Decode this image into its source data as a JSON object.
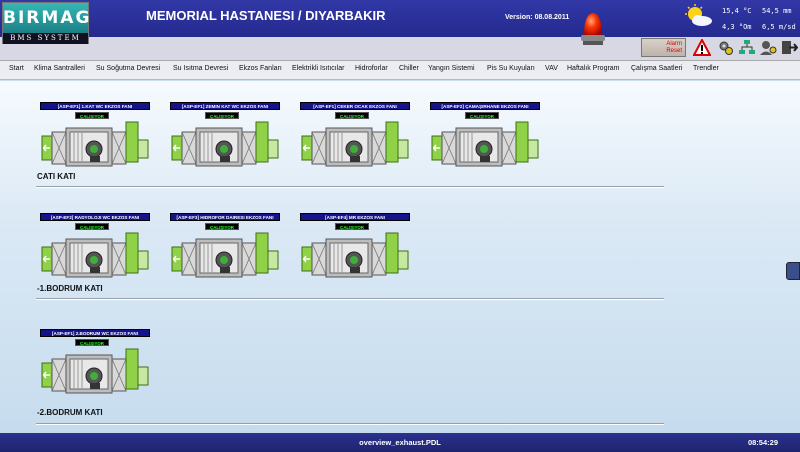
{
  "header": {
    "logo_main": "BIRMAG",
    "logo_sub": "BMS SYSTEM",
    "title": "MEMORIAL HASTANESI / DIYARBAKIR",
    "version": "Version: 08.08.2011"
  },
  "weather": {
    "temp": "15,4 °C",
    "pressure": "54,5 mm",
    "humidity": "4,3 °Om",
    "wind": "6,5 m/sd"
  },
  "toolbar": {
    "alarm_reset_line1": "Alarm",
    "alarm_reset_line2": "Reset"
  },
  "nav": [
    "Start",
    "Klima Santralleri",
    "Su Soğutma Devresi",
    "Su Isıtma Devresi",
    "Ekzos Fanları",
    "Elektrikli Isıtıcılar",
    "Hidroforlar",
    "Chiller",
    "Yangın Sistemi",
    "Pis Su Kuyuları",
    "VAV",
    "Haftalık Program",
    "Çalışma Saatleri",
    "Trendler"
  ],
  "floors": [
    {
      "label": "CATI KATI",
      "fans": [
        {
          "title": "[ASP-EF1] 1.KAT WC EKZOS FANI",
          "status": "ÇALIŞIYOR"
        },
        {
          "title": "[ASP-EF1] ZEMIN KAT WC EKZOS FANI",
          "status": "ÇALIŞIYOR"
        },
        {
          "title": "[ASP-EF1] CEKER OCAK EKZOS FANI",
          "status": "ÇALIŞIYOR"
        },
        {
          "title": "[ASP-EF2] ÇAMAŞIRHANE EKZOS FANI",
          "status": "ÇALIŞIYOR"
        }
      ]
    },
    {
      "label": "-1.BODRUM KATI",
      "fans": [
        {
          "title": "[ASP-EF2] RADYOLOJI WC EKZOS FANI",
          "status": "ÇALIŞIYOR"
        },
        {
          "title": "[ASP-EF3] HIDROFOR DAIRESI EKZOS FANI",
          "status": "ÇALIŞIYOR"
        },
        {
          "title": "[ASP-EF4] MR EKZOS FANI",
          "status": "ÇALIŞIYOR"
        }
      ]
    },
    {
      "label": "-2.BODRUM KATI",
      "fans": [
        {
          "title": "[ASP-EF1] 2.BODRUM WC EKZOS FANI",
          "status": "ÇALIŞIYOR"
        }
      ]
    }
  ],
  "footer": {
    "file": "overview_exhaust.PDL",
    "time": "08:54:29"
  }
}
